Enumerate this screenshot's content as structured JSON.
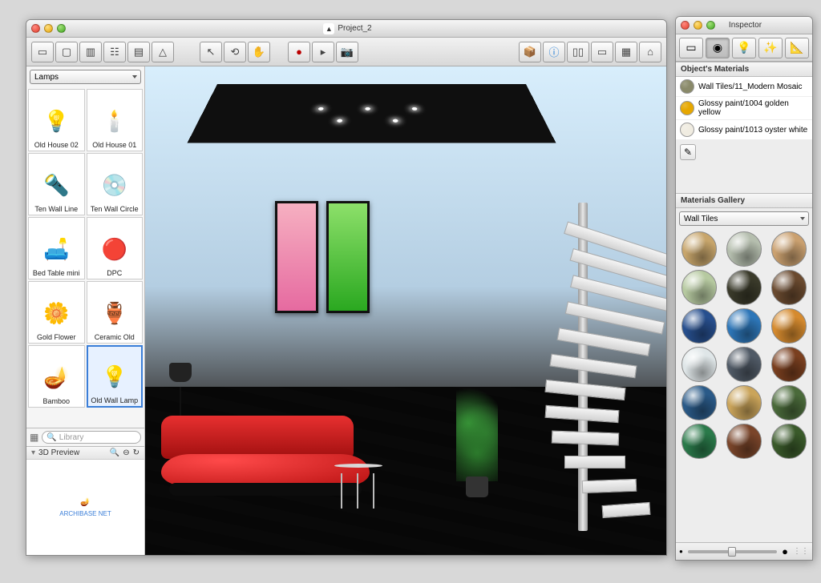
{
  "main_window": {
    "title": "Project_2",
    "toolbar_left": [
      "room-icon",
      "door-icon",
      "window-icon",
      "furniture-icon",
      "wall-icon",
      "roof-icon"
    ],
    "toolbar_mid": [
      "pointer-icon",
      "rotate-icon",
      "hand-icon"
    ],
    "toolbar_rec": [
      "record-icon",
      "play-icon",
      "camera-icon"
    ],
    "toolbar_right": [
      "box-icon",
      "info-icon",
      "view-split-icon",
      "view-single-icon",
      "view-grid-icon",
      "home-icon"
    ]
  },
  "sidebar": {
    "category": "Lamps",
    "search_placeholder": "Library",
    "preview_label": "3D Preview",
    "preview_footer": "ARCHIBASE NET",
    "items": [
      {
        "label": "Old House 02",
        "icon": "💡"
      },
      {
        "label": "Old House 01",
        "icon": "🕯️"
      },
      {
        "label": "Ten Wall Line",
        "icon": "🔦"
      },
      {
        "label": "Ten Wall Circle",
        "icon": "💿"
      },
      {
        "label": "Bed Table mini",
        "icon": "🛋️"
      },
      {
        "label": "DPC",
        "icon": "🔴"
      },
      {
        "label": "Gold Flower",
        "icon": "🌼"
      },
      {
        "label": "Ceramic Old",
        "icon": "🏺"
      },
      {
        "label": "Bamboo",
        "icon": "🪔"
      },
      {
        "label": "Old Wall Lamp",
        "icon": "💡",
        "selected": true
      }
    ]
  },
  "inspector": {
    "title": "Inspector",
    "tabs": [
      "properties-icon",
      "materials-icon",
      "light-icon",
      "effects-icon",
      "dimensions-icon"
    ],
    "active_tab": 1,
    "object_materials_label": "Object's Materials",
    "materials": [
      {
        "name": "Wall Tiles/11_Modern Mosaic",
        "color": "#8a8a6a"
      },
      {
        "name": "Glossy paint/1004 golden yellow",
        "color": "#e6a700"
      },
      {
        "name": "Glossy paint/1013 oyster white",
        "color": "#f0ece1"
      }
    ],
    "gallery_label": "Materials Gallery",
    "gallery_category": "Wall Tiles",
    "swatches": [
      "#c7a56b",
      "#b5beae",
      "#caa06f",
      "#b6c9a0",
      "#3a3a2a",
      "#6a4a2f",
      "#274f8e",
      "#2d76b8",
      "#d58a2e",
      "#dfe6e8",
      "#505a66",
      "#7a3f1f",
      "#2a5a88",
      "#caa45a",
      "#4a6a3a",
      "#2a7a4a",
      "#7a452a",
      "#3a5a2a"
    ]
  }
}
